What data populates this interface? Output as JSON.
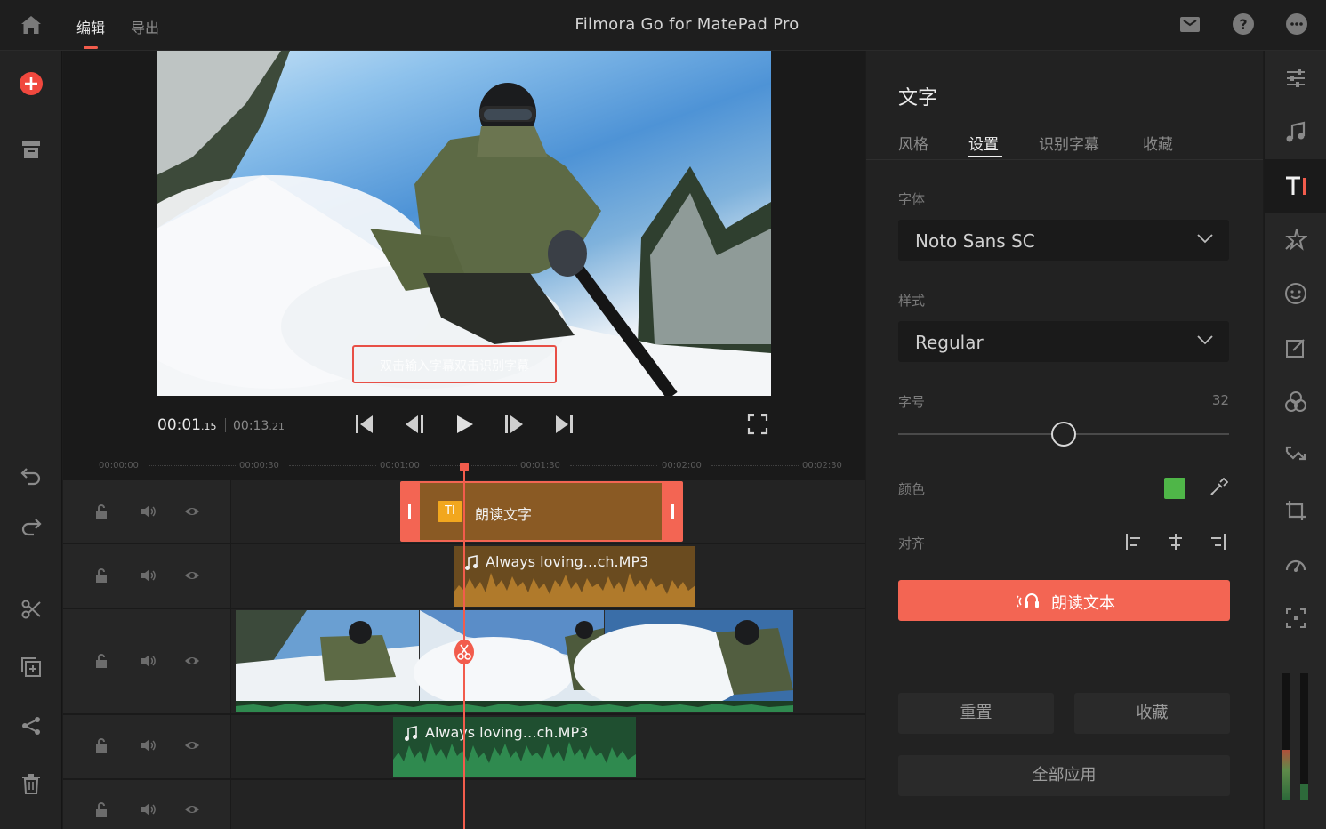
{
  "app": {
    "title": "Filmora Go for MatePad Pro"
  },
  "top_tabs": [
    {
      "label": "编辑",
      "active": true
    },
    {
      "label": "导出",
      "active": false
    }
  ],
  "top_icons": [
    "home-icon",
    "message-icon",
    "help-icon",
    "more-icon"
  ],
  "left_toolbar": [
    "add-icon",
    "archive-icon",
    "undo-icon",
    "redo-icon",
    "split-icon",
    "duplicate-icon",
    "share-icon",
    "delete-icon"
  ],
  "preview": {
    "subtitle_placeholder": "双击输入字幕双击识别字幕",
    "time_current_main": "00:01",
    "time_current_frac": ".15",
    "time_total": "00:13",
    "time_total_frac": ".21"
  },
  "ruler": [
    "00:00:00",
    "00:00:30",
    "00:01:00",
    "00:01:30",
    "00:02:00",
    "00:02:30"
  ],
  "timeline": {
    "text_clip": {
      "icon": "TI",
      "label": "朗读文字"
    },
    "audio_clip_1": {
      "label": "Always loving…ch.MP3",
      "color": "#b07a2b"
    },
    "audio_clip_2": {
      "label": "Always loving…ch.MP3",
      "color": "#2f8a4f"
    }
  },
  "panel": {
    "title": "文字",
    "tabs": [
      {
        "label": "风格"
      },
      {
        "label": "设置",
        "active": true
      },
      {
        "label": "识别字幕"
      },
      {
        "label": "收藏"
      }
    ],
    "font_label": "字体",
    "font_value": "Noto Sans SC",
    "style_label": "样式",
    "style_value": "Regular",
    "size_label": "字号",
    "size_value": "32",
    "size_fraction": 0.5,
    "color_label": "颜色",
    "color_value": "#4fb648",
    "align_label": "对齐",
    "read_button": "朗读文本",
    "reset_button": "重置",
    "favorite_button": "收藏",
    "apply_all_button": "全部应用",
    "accent_color": "#f36553"
  },
  "right_toolbar": [
    "adjust-icon",
    "music-icon",
    "text-icon",
    "effects-icon",
    "sticker-icon",
    "edit-note-icon",
    "filter-icon",
    "transition-icon",
    "crop-icon",
    "speed-icon",
    "fit-icon"
  ]
}
